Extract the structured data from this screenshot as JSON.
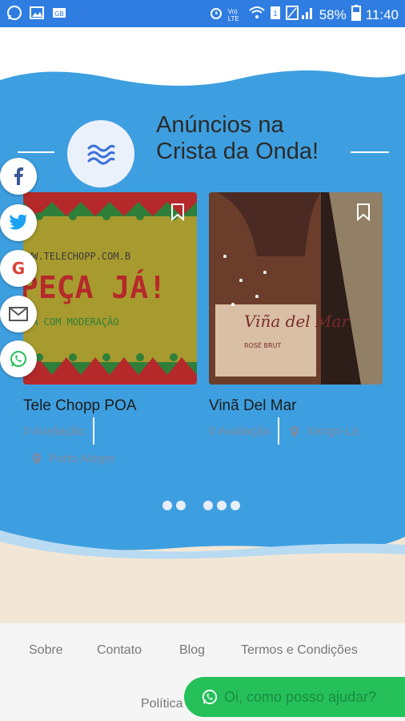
{
  "status_bar": {
    "battery": "58%",
    "time": "11:40",
    "network": "Vo) LTE"
  },
  "section": {
    "title": "Anúncios na Crista da Onda!"
  },
  "cards": [
    {
      "title": "Tele Chopp POA",
      "rating": "0 Avaliação",
      "location": "Porto Alegre",
      "image_text": [
        "WW.TELECHOPP.COM.B",
        "PEÇA JÁ!",
        "BA COM MODERAÇÃO"
      ]
    },
    {
      "title": "Vinã Del Mar",
      "rating": "0 Avaliação",
      "location": "Xangri-Lá",
      "image_text": [
        "Viña del Mar",
        "ROSÉ BRUT"
      ]
    }
  ],
  "social": [
    "facebook-icon",
    "twitter-icon",
    "google-icon",
    "mail-icon",
    "whatsapp-icon"
  ],
  "footer": {
    "links": [
      "Sobre",
      "Contato",
      "Blog",
      "Termos e Condições"
    ],
    "policy": "Política",
    "whatsapp_label": "Oi, como posso ajudar?"
  },
  "colors": {
    "status_bar": "#2f7de1",
    "band": "#3e9fe0",
    "beige": "#f2e7d6",
    "whatsapp": "#25c05a"
  }
}
